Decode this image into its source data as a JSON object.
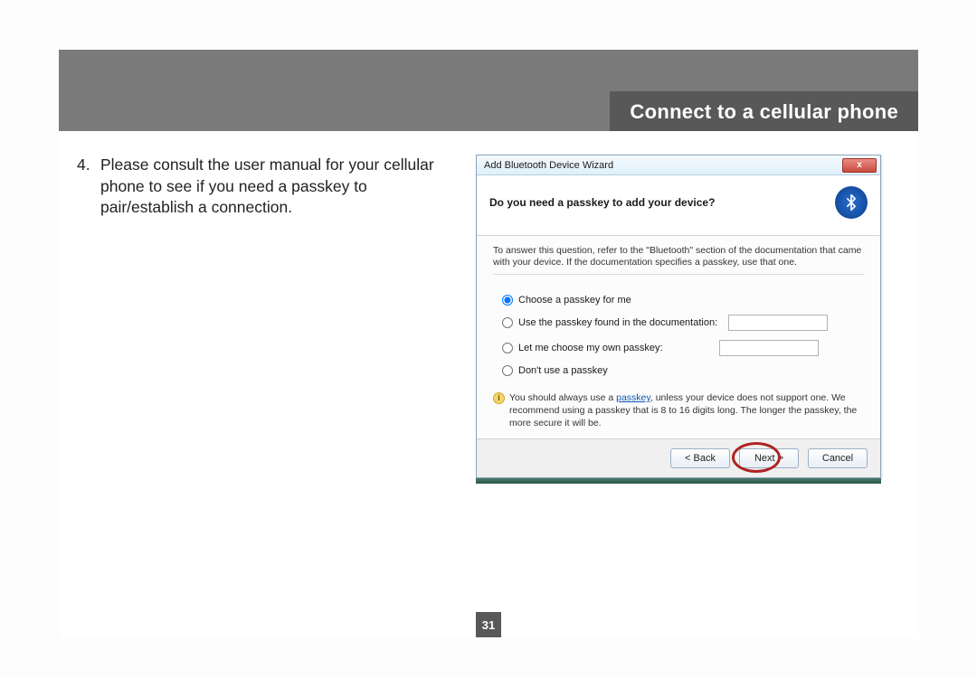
{
  "header": {
    "title": "Connect to a cellular phone"
  },
  "step": {
    "number": "4.",
    "text": "Please consult the user manual for your cellular phone to see if you need a passkey to pair/establish a connection."
  },
  "dialog": {
    "title": "Add Bluetooth Device Wizard",
    "close_glyph": "x",
    "heading": "Do you need a passkey to add your device?",
    "instruction": "To answer this question, refer to the \"Bluetooth\" section of the documentation that came with your device. If the documentation specifies a passkey, use that one.",
    "options": {
      "choose": "Choose a passkey for me",
      "doc": "Use the passkey found in the documentation:",
      "own": "Let me choose my own passkey:",
      "none": "Don't use a passkey"
    },
    "note_prefix": "You should always use a ",
    "note_link": "passkey",
    "note_suffix": ", unless your device does not support one. We recommend using a passkey that is 8 to 16 digits long. The longer the passkey, the more secure it will be.",
    "buttons": {
      "back": "< Back",
      "next": "Next >",
      "cancel": "Cancel"
    }
  },
  "page_number": "31"
}
